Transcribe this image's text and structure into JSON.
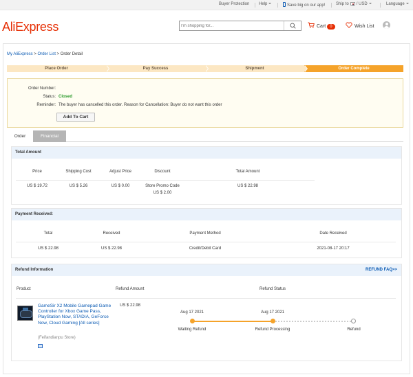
{
  "topbar": {
    "buyer_protection": "Buyer Protection",
    "help": "Help",
    "app": "Save big on our app!",
    "ship_to": "Ship to",
    "currency": "USD",
    "language": "Language"
  },
  "header": {
    "logo": "AliExpress",
    "search_placeholder": "I'm shopping for...",
    "cart_label": "Cart",
    "cart_count": "0",
    "wishlist_label": "Wish List"
  },
  "breadcrumb": {
    "my": "My AliExpress",
    "sep1": " > ",
    "list": "Order List",
    "sep2": " > ",
    "current": "Order Detail"
  },
  "steps": [
    "Place Order",
    "Pay Success",
    "Shipment",
    "Order Complete"
  ],
  "order": {
    "number_label": "Order Number:",
    "number_value": "",
    "status_label": "Status:",
    "status_value": "Closed",
    "reminder_label": "Reminder:",
    "reminder_value": "The buyer has cancelled this order. Reason for Cancellation: Buyer do not want this order",
    "add_to_cart": "Add To Cart"
  },
  "tabs": {
    "order": "Order",
    "financial": "Financial"
  },
  "total_amount": {
    "title": "Total Amount",
    "headers": [
      "Price",
      "Shipping Cost",
      "Adjust Price",
      "Discount",
      "Total Amount"
    ],
    "row": [
      "US $ 19.72",
      "US $ 5.26",
      "US $ 0.00",
      "Store Promo Code",
      "US $ 22.98"
    ],
    "discount_value": "US $ 2.00"
  },
  "payment": {
    "title": "Payment Received:",
    "headers": [
      "Total",
      "Received",
      "Payment Method",
      "Date Received"
    ],
    "row": [
      "US $ 22.98",
      "US $ 22.98",
      "Credit/Debit Card",
      "2021-08-17 20:17"
    ]
  },
  "refund": {
    "title": "Refund Information",
    "faq": "REFUND FAQ>>",
    "headers": [
      "Product",
      "Refund Amount",
      "Refund Status"
    ],
    "product_title": "GameSir X2 Mobile Gamepad Game Controller for Xbox Game Pass, PlayStation Now, STADIA, GeForce Now, Cloud Gaming [All series]",
    "store": "(Feifandianpu Store)",
    "amount": "US $ 22.98",
    "timeline": [
      {
        "date": "Aug 17 2021",
        "label": "Waiting Refund",
        "done": true
      },
      {
        "date": "Aug 17 2021",
        "label": "Refund Processing",
        "done": true
      },
      {
        "date": "",
        "label": "Refund",
        "done": false
      }
    ]
  },
  "colors": {
    "brand": "#e62e04",
    "link": "#0a5ab3",
    "progress": "#f5a32a",
    "closed": "#2a9a2a"
  }
}
